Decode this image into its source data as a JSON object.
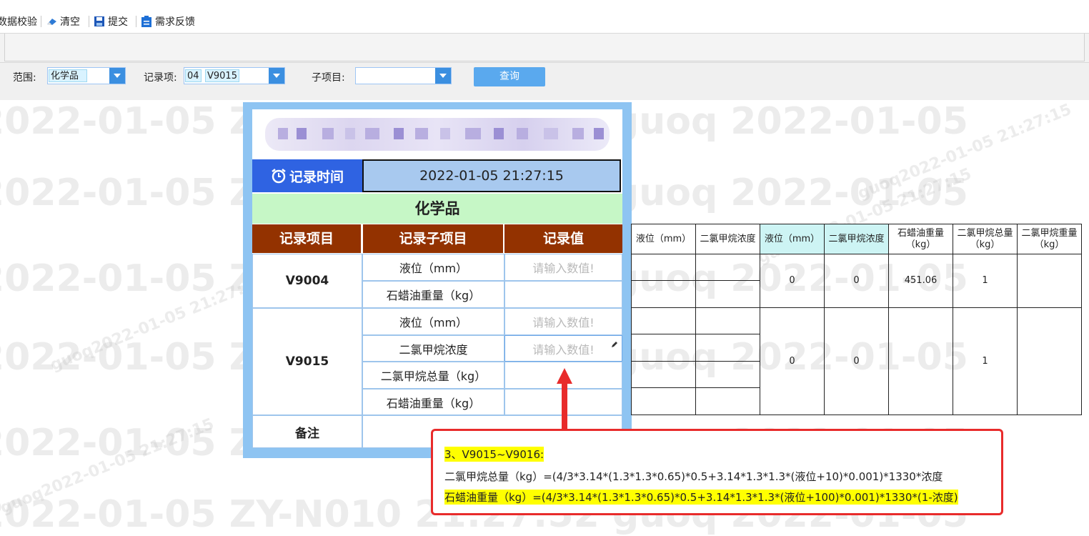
{
  "toolbar": {
    "validate_label": "数据校验",
    "clear_label": "清空",
    "submit_label": "提交",
    "feedback_label": "需求反馈"
  },
  "filters": {
    "scope_label": "范围:",
    "scope_value": "化学品",
    "record_label": "记录项:",
    "record_code": "04",
    "record_value": "V9015",
    "sub_label": "子项目:",
    "sub_value": "",
    "query_label": "查询"
  },
  "watermark": {
    "main": "2022-01-05  ZY-N010  21:27:52  guoq  2022-01-05",
    "small": "guoq2022-01-05 21:27:15"
  },
  "form": {
    "time_label": "记录时间",
    "time_value": "2022-01-05 21:27:15",
    "category": "化学品",
    "headers": [
      "记录项目",
      "记录子项目",
      "记录值"
    ],
    "groups": [
      {
        "name": "V9004",
        "items": [
          {
            "sub": "液位（mm）",
            "value": "请输入数值!"
          },
          {
            "sub": "石蜡油重量（kg）",
            "value": ""
          }
        ]
      },
      {
        "name": "V9015",
        "items": [
          {
            "sub": "液位（mm）",
            "value": "请输入数值!"
          },
          {
            "sub": "二氯甲烷浓度",
            "value": "请输入数值!"
          },
          {
            "sub": "二氯甲烷总量（kg）",
            "value": ""
          },
          {
            "sub": "石蜡油重量（kg）",
            "value": ""
          }
        ]
      }
    ],
    "remark_label": "备注",
    "remark_value": ""
  },
  "right_table": {
    "headers": [
      "液位（mm）",
      "二氯甲烷浓度",
      "液位（mm）",
      "二氯甲烷浓度",
      "石蜡油重量（kg）",
      "二氯甲烷总量（kg）",
      "二氯甲烷重量（kg）"
    ],
    "row1": {
      "level": "0",
      "conc": "0",
      "wax": "451.06",
      "total": "1"
    },
    "row2": {
      "level": "0",
      "conc": "0",
      "wax": "",
      "total": "1"
    }
  },
  "callout": {
    "title": "3、V9015~V9016:",
    "formula1_label": "二氯甲烷总量（kg）",
    "formula1": "=(4/3*3.14*(1.3*1.3*0.65)*0.5+3.14*1.3*1.3*(液位+10)*0.001)*1330*浓度",
    "formula2_label": "石蜡油重量（kg）",
    "formula2": "=(4/3*3.14*(1.3*1.3*0.65)*0.5+3.14*1.3*1.3*(液位+100)*0.001)*1330*(1-浓度)"
  },
  "colors": {
    "accent": "#3b8fe0",
    "header_brown": "#933200",
    "time_blue": "#2f63e2",
    "category_green": "#c6f7c6",
    "callout_red": "#e82b2b",
    "highlight_yellow": "#ffff00"
  }
}
